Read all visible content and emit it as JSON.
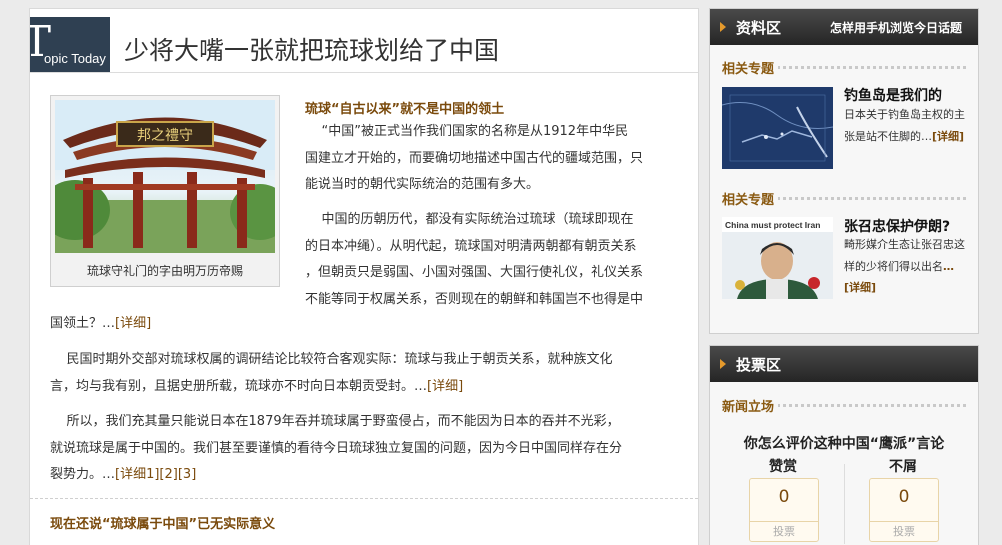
{
  "badge": {
    "letter": "T",
    "rest": "opic Today"
  },
  "article": {
    "headline": "少将大嘴一张就把琉球划给了中国",
    "figure_caption": "琉球守礼门的字由明万历帝赐",
    "section1_title": "琉球“自古以来”就不是中国的领土",
    "p1_lines": [
      "    “中国”被正式当作我们国家的名称是从1912年中华民",
      "国建立才开始的，而要确切地描述中国古代的疆域范围，只",
      "能说当时的朝代实际统治的范围有多大。"
    ],
    "p2_lines": [
      "    中国的历朝历代，都没有实际统治过琉球（琉球即现在",
      "的日本冲绳）。从明代起，琉球国对明清两朝都有朝贡关系",
      "，但朝贡只是弱国、小国对强国、大国行使礼仪，礼仪关系",
      "不能等同于权属关系，否则现在的朝鲜和韩国岂不也得是中"
    ],
    "p2_last": "国领土？…",
    "more": "[详细]",
    "p3_lines": [
      "    民国时期外交部对琉球权属的调研结论比较符合客观实际：琉球与我止于朝贡关系，就种族文化",
      "言，均与我有别，且据史册所载，琉球亦不时向日本朝贡受封。…"
    ],
    "p4_lines": [
      "    所以，我们充其量只能说日本在1879年吞并琉球属于野蛮侵占，而不能因为日本的吞并不光彩，",
      "就说琉球是属于中国的。我们甚至要谨慎的看待今日琉球独立复国的问题，因为今日中国同样存在分",
      "裂势力。…"
    ],
    "p4_more": "[详细1][2][3]",
    "section2_title": "现在还说“琉球属于中国”已无实际意义"
  },
  "sidebar": {
    "info_box": {
      "label": "资料区",
      "link": "怎样用手机浏览今日话题",
      "items": [
        {
          "section": "相关专题",
          "title": "钓鱼岛是我们的",
          "text": "日本关于钓鱼岛主权的主张是站不住脚的…",
          "more": "[详细]",
          "thumb_text": ""
        },
        {
          "section": "相关专题",
          "title": "张召忠保护伊朗?",
          "text": "畸形媒介生态让张召忠这样的少将们得以出名",
          "more": "…[详细]",
          "thumb_text": "China must protect Iran"
        }
      ]
    },
    "vote_box": {
      "label": "投票区",
      "section": "新闻立场",
      "question": "你怎么评价这种中国“鹰派”言论",
      "options": [
        {
          "label": "赞赏",
          "count": "0",
          "button": "投票"
        },
        {
          "label": "不屑",
          "count": "0",
          "button": "投票"
        }
      ]
    }
  },
  "colors": {
    "accent": "#7a4a0c",
    "badge": "#2f4052",
    "header_dark": "#2a2a2a"
  }
}
